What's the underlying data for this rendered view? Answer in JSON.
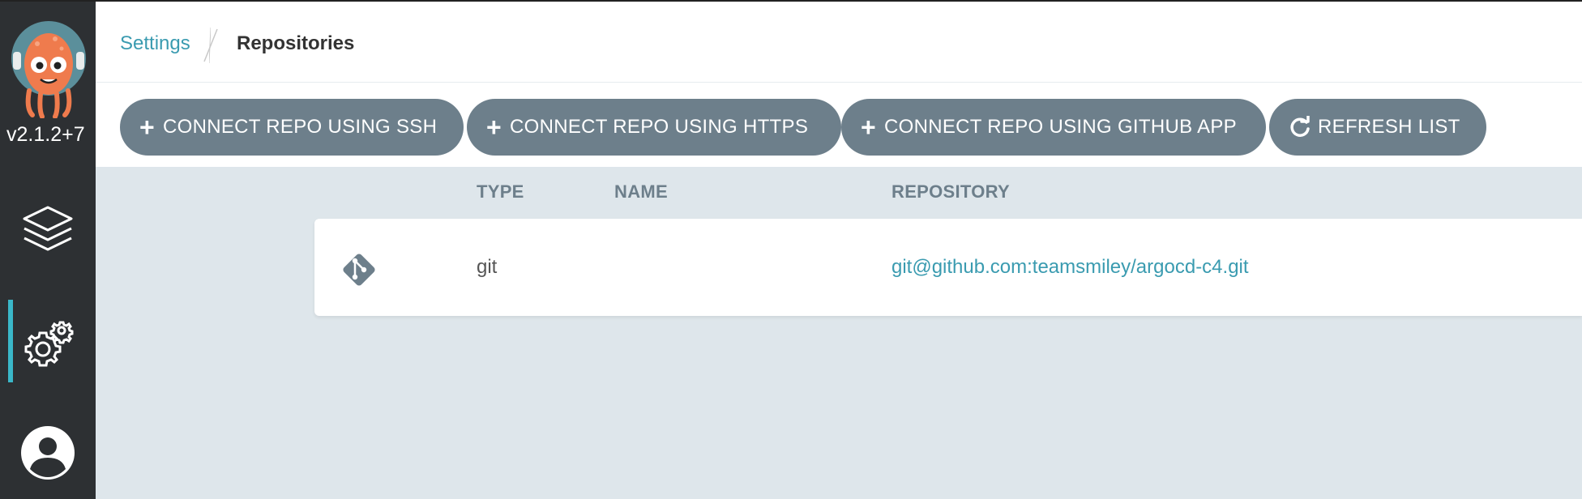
{
  "sidebar": {
    "version": "v2.1.2+7",
    "items": [
      {
        "name": "applications",
        "icon": "layers-icon"
      },
      {
        "name": "settings",
        "icon": "gears-icon",
        "active": true
      },
      {
        "name": "user-info",
        "icon": "user-circle-icon"
      }
    ]
  },
  "breadcrumb": {
    "parent": "Settings",
    "current": "Repositories"
  },
  "toolbar": {
    "ssh_label": "CONNECT REPO USING SSH",
    "https_label": "CONNECT REPO USING HTTPS",
    "github_app_label": "CONNECT REPO USING GITHUB APP",
    "refresh_label": "REFRESH LIST"
  },
  "table": {
    "headers": [
      "TYPE",
      "NAME",
      "REPOSITORY"
    ],
    "rows": [
      {
        "icon": "git-icon",
        "type": "git",
        "name": "",
        "repository": "git@github.com:teamsmiley/argocd-c4.git"
      }
    ]
  },
  "colors": {
    "sidebar_bg": "#2d3033",
    "accent": "#3ab7c9",
    "button_bg": "#6d7f8b",
    "link": "#3a9bb0",
    "content_bg": "#dee6eb"
  }
}
